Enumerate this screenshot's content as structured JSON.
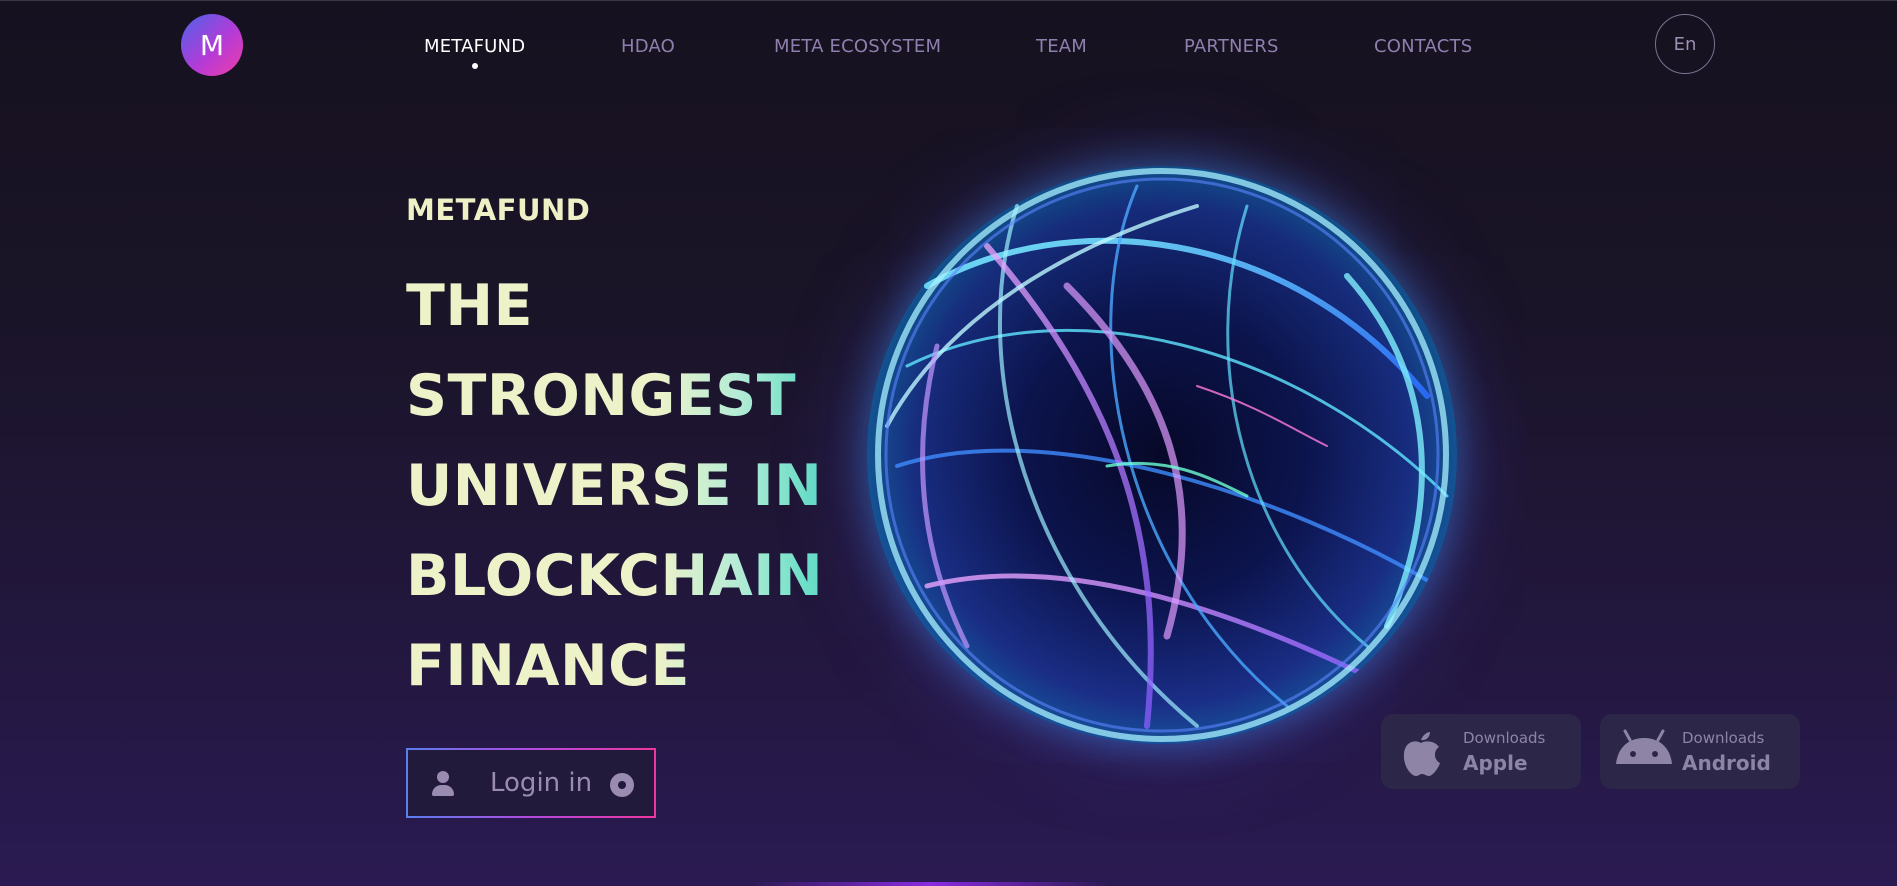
{
  "logo": {
    "letter": "M"
  },
  "nav": {
    "items": [
      {
        "label": "METAFUND",
        "active": true
      },
      {
        "label": "HDAO",
        "active": false
      },
      {
        "label": "META ECOSYSTEM",
        "active": false
      },
      {
        "label": "TEAM",
        "active": false
      },
      {
        "label": "PARTNERS",
        "active": false
      },
      {
        "label": "CONTACTS",
        "active": false
      }
    ],
    "language": "En"
  },
  "hero": {
    "eyebrow": "METAFUND",
    "headline_lines": [
      "THE",
      "STRONGEST",
      "UNIVERSE IN",
      "BLOCKCHAIN",
      "FINANCE"
    ],
    "login_label": "Login in"
  },
  "downloads": [
    {
      "caption": "Downloads",
      "platform": "Apple",
      "icon": "apple-icon"
    },
    {
      "caption": "Downloads",
      "platform": "Android",
      "icon": "android-icon"
    }
  ],
  "colors": {
    "background": "#1a1428",
    "headline_start": "#eef2c9",
    "headline_end": "#5fdcc6",
    "accent_pink": "#f0359e",
    "accent_blue": "#5a7ef0",
    "nav_inactive": "#8f7fae"
  }
}
